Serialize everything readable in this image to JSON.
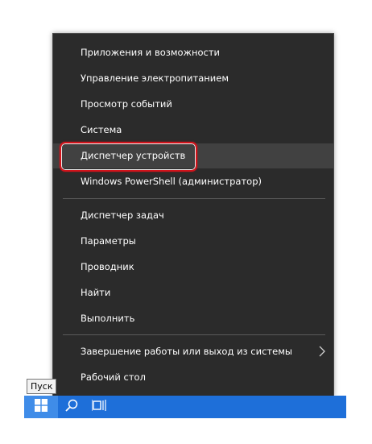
{
  "menu": {
    "items": [
      {
        "label": "Приложения и возможности"
      },
      {
        "label": "Управление электропитанием"
      },
      {
        "label": "Просмотр событий"
      },
      {
        "label": "Система"
      },
      {
        "label": "Диспетчер устройств"
      },
      {
        "label": "Windows PowerShell (администратор)"
      },
      {
        "label": "Диспетчер задач"
      },
      {
        "label": "Параметры"
      },
      {
        "label": "Проводник"
      },
      {
        "label": "Найти"
      },
      {
        "label": "Выполнить"
      },
      {
        "label": "Завершение работы или выход из системы"
      },
      {
        "label": "Рабочий стол"
      }
    ],
    "submenu_icon": "chevron-right-icon"
  },
  "tooltip": {
    "text": "Пуск"
  },
  "taskbar": {
    "start_icon": "windows-logo-icon",
    "search_icon": "search-icon",
    "task_view_icon": "task-view-icon"
  },
  "colors": {
    "menu_background": "#2b2b2b",
    "menu_hover": "#414141",
    "highlight_border": "#d4131b",
    "taskbar": "#1e6fd9",
    "start_button": "#3f8ce8"
  }
}
